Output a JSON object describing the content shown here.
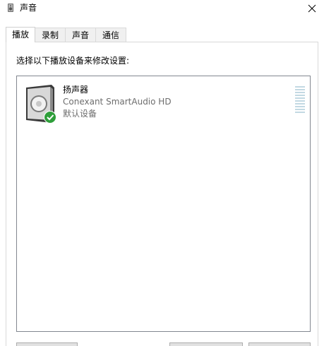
{
  "window": {
    "title": "声音",
    "title_icon": "speaker-icon",
    "close_icon": "close-icon"
  },
  "tabs": [
    {
      "label": "播放",
      "active": true
    },
    {
      "label": "录制",
      "active": false
    },
    {
      "label": "声音",
      "active": false
    },
    {
      "label": "通信",
      "active": false
    }
  ],
  "playback": {
    "instruction": "选择以下播放设备来修改设置:",
    "devices": [
      {
        "name": "扬声器",
        "description": "Conexant SmartAudio HD",
        "status": "默认设备",
        "icon": "speaker-icon",
        "badge": "default-check-icon",
        "badge_color": "#2e9e3a",
        "level_meter_bars": 10
      }
    ]
  },
  "buttons": {
    "configure_label": "",
    "set_default_label": "",
    "properties_label": ""
  }
}
